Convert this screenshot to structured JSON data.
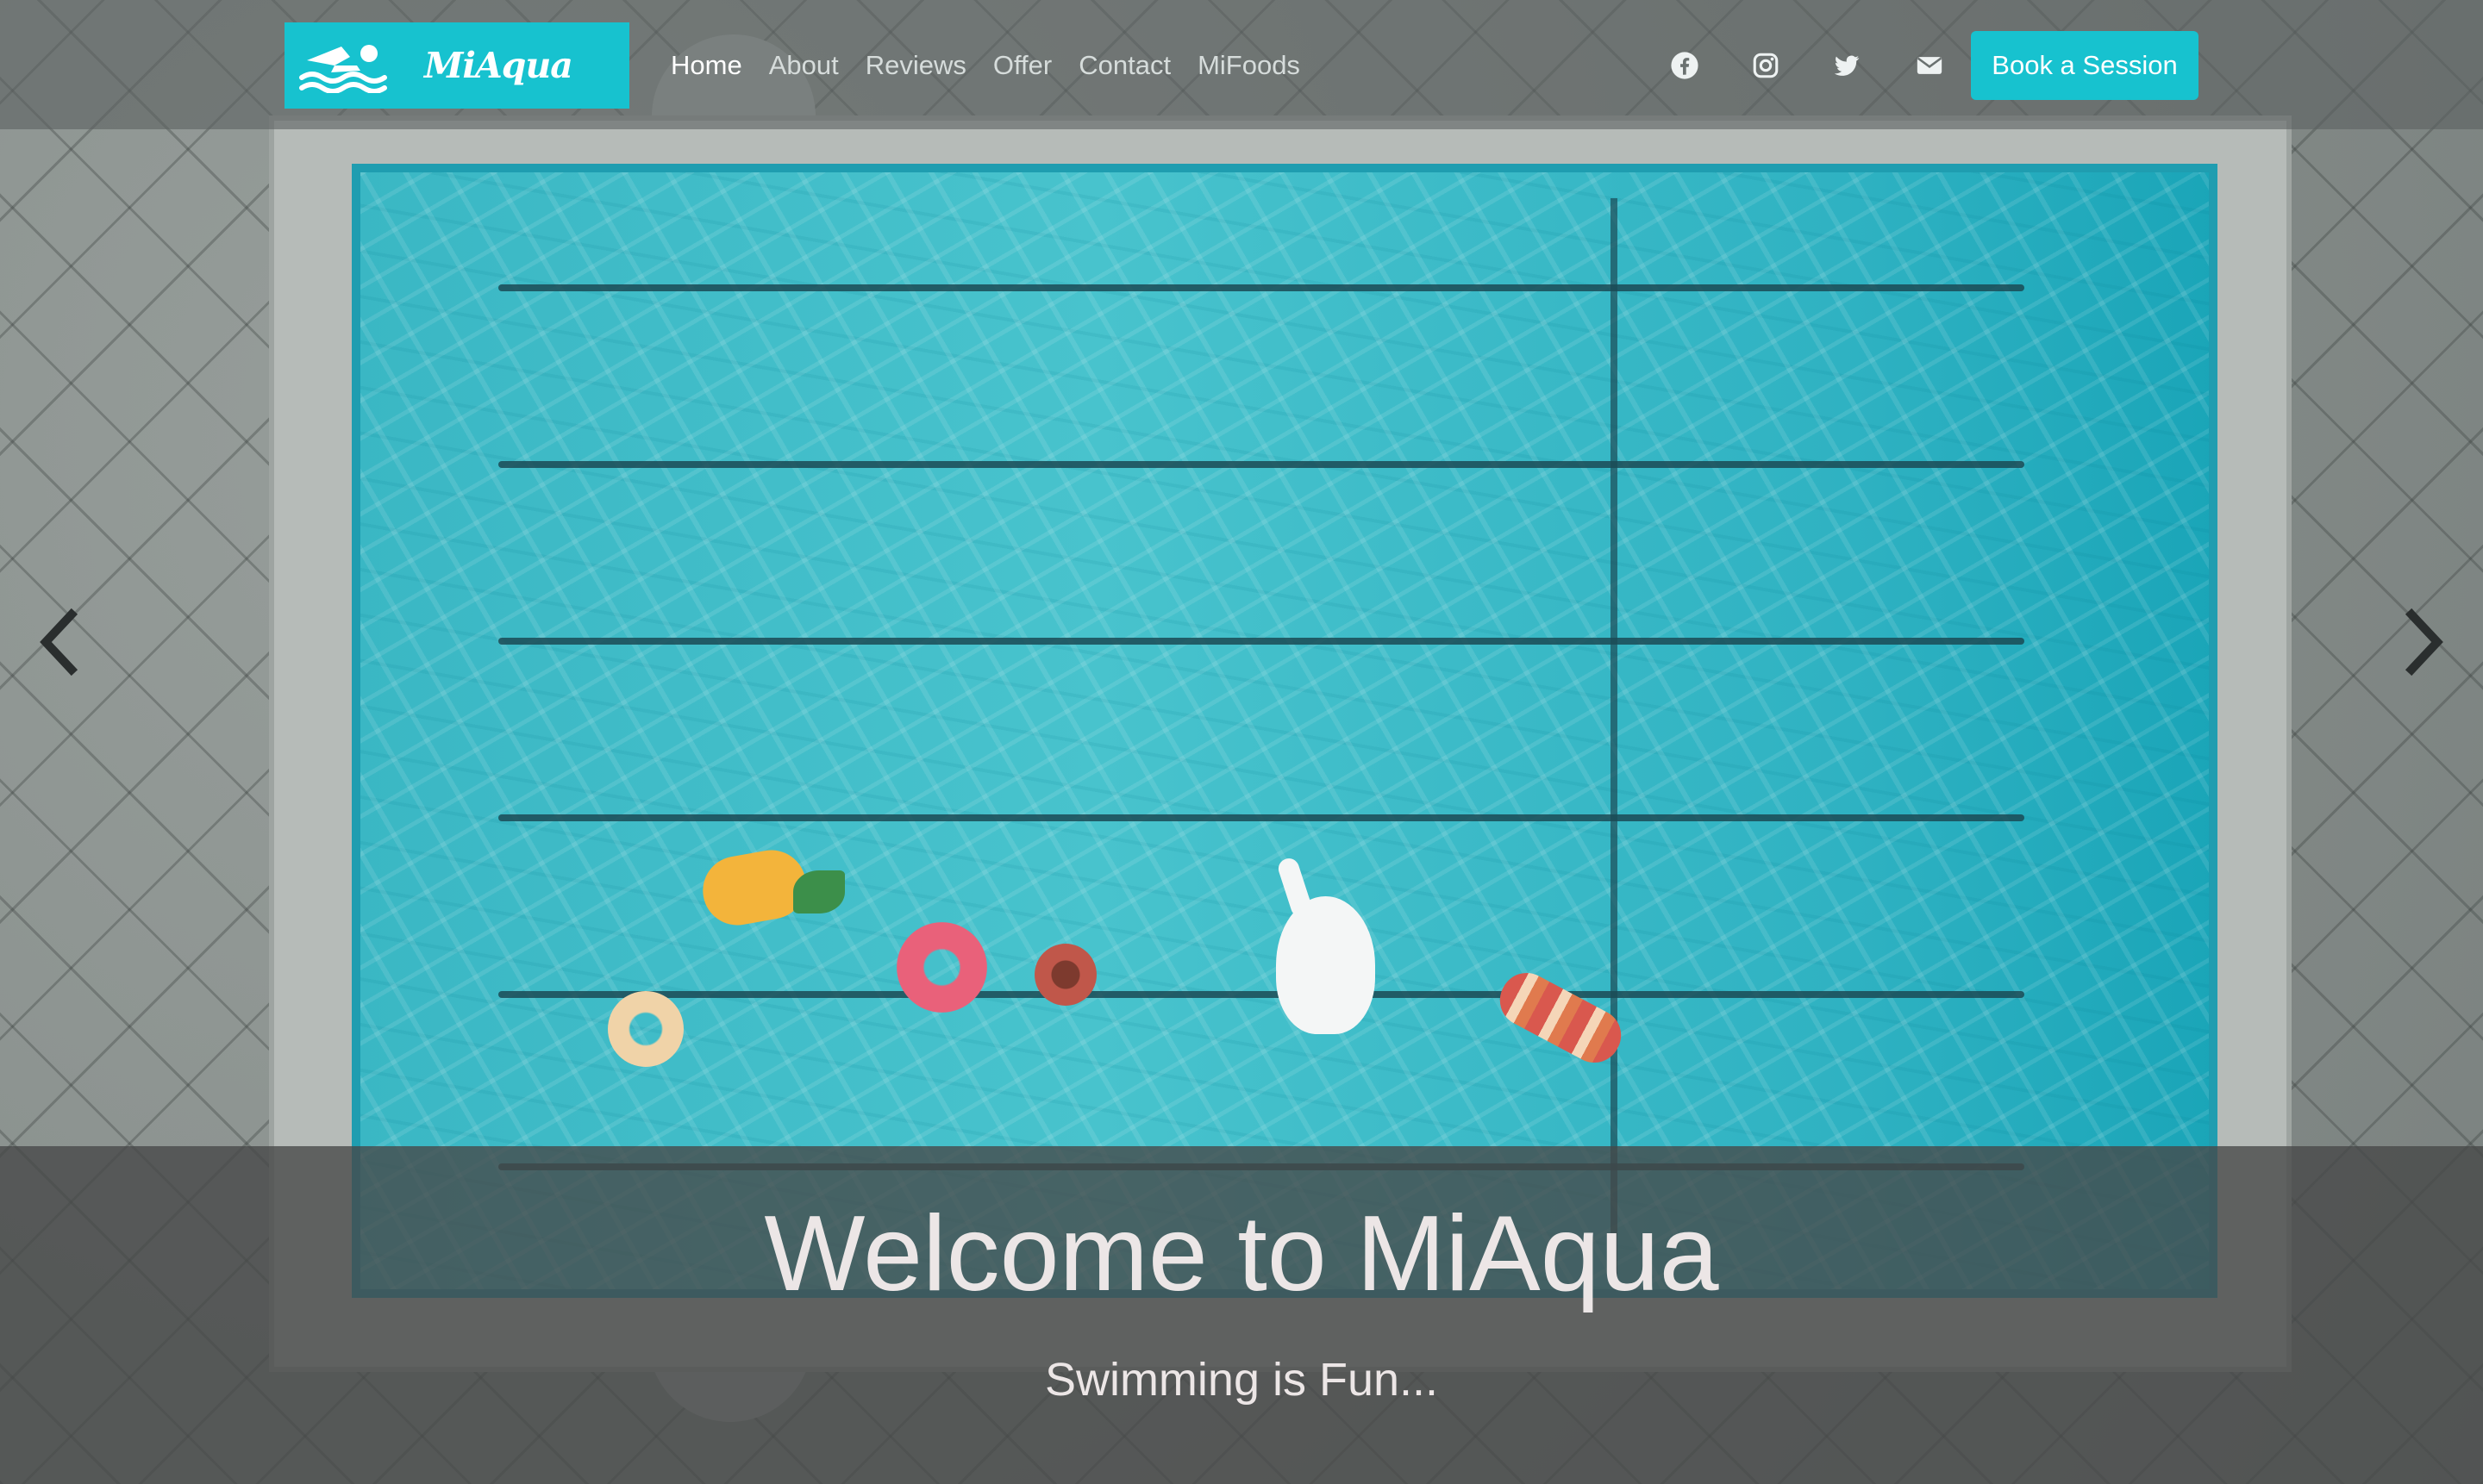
{
  "brand": {
    "name": "MiAqua",
    "icon": "swimmer-icon",
    "color": "#17c2cf"
  },
  "nav": {
    "links": [
      {
        "label": "Home",
        "active": true
      },
      {
        "label": "About",
        "active": false
      },
      {
        "label": "Reviews",
        "active": false
      },
      {
        "label": "Offer",
        "active": false
      },
      {
        "label": "Contact",
        "active": false
      },
      {
        "label": "MiFoods",
        "active": false
      }
    ],
    "social": [
      "facebook-icon",
      "instagram-icon",
      "twitter-icon",
      "envelope-icon"
    ],
    "cta_label": "Book a Session"
  },
  "carousel": {
    "prev_icon": "chevron-left-icon",
    "next_icon": "chevron-right-icon"
  },
  "hero": {
    "title": "Welcome to MiAqua",
    "subtitle": "Swimming is Fun..."
  }
}
